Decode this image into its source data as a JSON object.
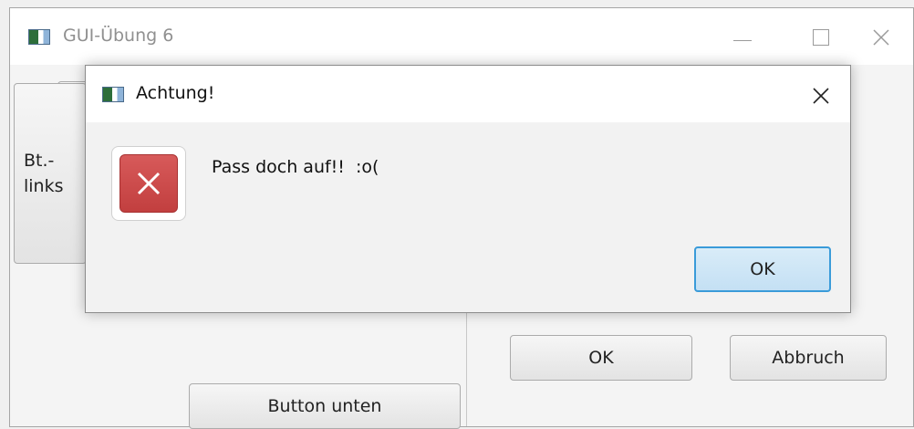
{
  "main_window": {
    "title": "GUI-Übung 6",
    "buttons": {
      "links": "Bt.-\nlinks",
      "unten": "Button unten",
      "ok": "OK",
      "abbruch": "Abbruch"
    }
  },
  "dialog": {
    "title": "Achtung!",
    "message": "Pass doch auf!!  :o(",
    "ok_label": "OK",
    "icon": "error-icon"
  },
  "colors": {
    "error_red": "#c94848",
    "ok_focus_border": "#3a9bd9",
    "ok_focus_fill": "#cfe6f6"
  }
}
